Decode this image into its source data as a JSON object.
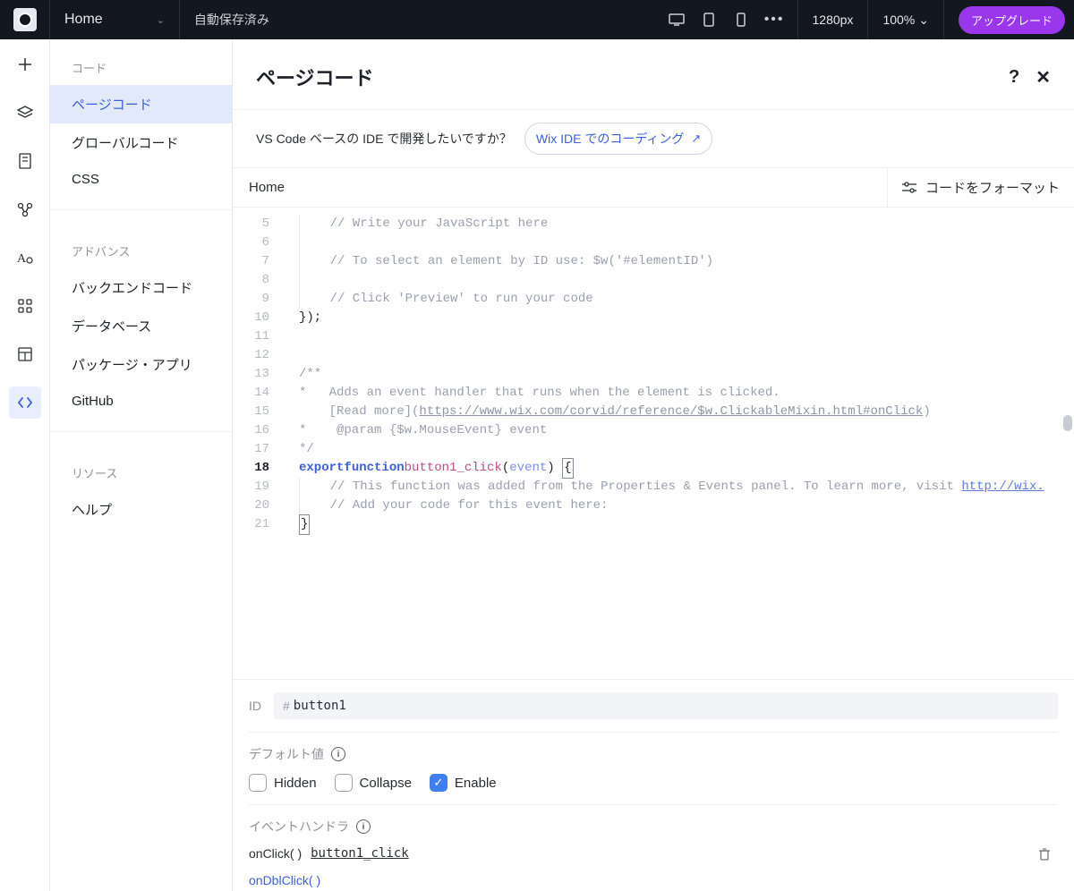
{
  "topbar": {
    "page_name": "Home",
    "autosave": "自動保存済み",
    "breakpoint": "1280px",
    "zoom": "100%",
    "upgrade": "アップグレード"
  },
  "sidepanel": {
    "section_code": "コード",
    "items_code": [
      "ページコード",
      "グローバルコード",
      "CSS"
    ],
    "section_advance": "アドバンス",
    "items_advance": [
      "バックエンドコード",
      "データベース",
      "パッケージ・アプリ",
      "GitHub"
    ],
    "section_resource": "リソース",
    "items_resource": [
      "ヘルプ"
    ]
  },
  "main": {
    "title": "ページコード",
    "ide_text": "VS Code ベースの IDE で開発したいですか？",
    "ide_button": "Wix IDE でのコーディング",
    "tab": "Home",
    "format_button": "コードをフォーマット"
  },
  "code": {
    "lines": [
      {
        "n": 5,
        "t": "    // Write your JavaScript here",
        "cls": "c-comm",
        "indent": 1
      },
      {
        "n": 6,
        "t": "",
        "indent": 1
      },
      {
        "n": 7,
        "t": "    // To select an element by ID use: $w('#elementID')",
        "cls": "c-comm",
        "indent": 1
      },
      {
        "n": 8,
        "t": "",
        "indent": 1
      },
      {
        "n": 9,
        "t": "    // Click 'Preview' to run your code",
        "cls": "c-comm",
        "indent": 1
      },
      {
        "n": 10,
        "t": "});",
        "indent": 0
      },
      {
        "n": 11,
        "t": "",
        "indent": 0
      },
      {
        "n": 12,
        "t": "",
        "indent": 0
      },
      {
        "n": 13,
        "t": "/**",
        "cls": "c-comm",
        "indent": 0
      },
      {
        "n": 14,
        "t": "*   Adds an event handler that runs when the element is clicked.",
        "cls": "c-comm",
        "indent": 0
      },
      {
        "n": 15,
        "special": "readmore"
      },
      {
        "n": 16,
        "t": "*    @param {$w.MouseEvent} event",
        "cls": "c-comm",
        "indent": 0
      },
      {
        "n": 17,
        "t": "*/",
        "cls": "c-comm",
        "indent": 0
      },
      {
        "n": 18,
        "special": "func",
        "hl": true
      },
      {
        "n": 19,
        "special": "line19"
      },
      {
        "n": 20,
        "t": "    // Add your code for this event here:",
        "cls": "c-comm",
        "indent": 1
      },
      {
        "n": 21,
        "special": "closebrace"
      }
    ],
    "readmore_pre": "    [Read more](",
    "readmore_url": "https://www.wix.com/corvid/reference/$w.ClickableMixin.html#onClick",
    "readmore_post": ")",
    "func_export": "export",
    "func_function": "function",
    "func_name": "button1_click",
    "func_param": "event",
    "line19_comment": "// This function was added from the Properties & Events panel. To learn more, visit ",
    "line19_url": "http://wix."
  },
  "props": {
    "id_label": "ID",
    "id_value": "button1",
    "defaults_label": "デフォルト値",
    "cb_hidden": "Hidden",
    "cb_collapse": "Collapse",
    "cb_enable": "Enable",
    "events_label": "イベントハンドラ",
    "ev_onclick": "onClick( )",
    "ev_onclick_handler": "button1_click",
    "ev_ondbl": "onDblClick( )"
  }
}
